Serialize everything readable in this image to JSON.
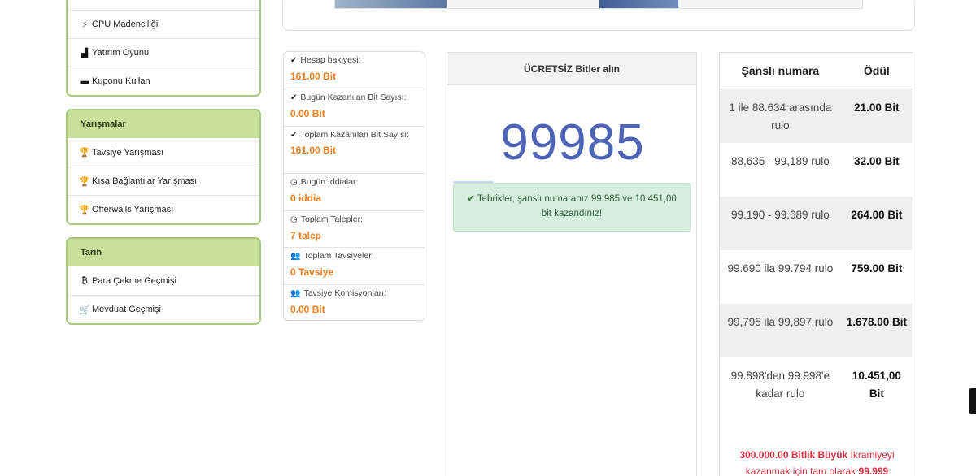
{
  "sidebar": {
    "top_items": [
      {
        "icon": "bolt-icon",
        "glyph": "⚡",
        "label": "CPU Madenciliği"
      },
      {
        "icon": "chart-icon",
        "glyph": "▟",
        "label": "Yatırım Oyunu"
      },
      {
        "icon": "ticket-icon",
        "glyph": "▬",
        "label": "Kuponu Kullan"
      }
    ],
    "contests": {
      "title": "Yarışmalar",
      "items": [
        {
          "icon": "trophy-icon",
          "glyph": "🏆",
          "label": "Tavsiye Yarışması"
        },
        {
          "icon": "trophy-icon",
          "glyph": "🏆",
          "label": "Kısa Bağlantılar Yarışması"
        },
        {
          "icon": "trophy-icon",
          "glyph": "🏆",
          "label": "Offerwalls Yarışması"
        }
      ]
    },
    "history": {
      "title": "Tarih",
      "items": [
        {
          "icon": "bitcoin-icon",
          "glyph": "₿",
          "label": "Para Çekme Geçmişi"
        },
        {
          "icon": "cart-icon",
          "glyph": "🛒",
          "label": "Mevduat Geçmişi"
        }
      ]
    }
  },
  "stats": [
    {
      "icon": "check-circle-icon",
      "glyph": "✔",
      "label": "Hesap bakiyesi:",
      "value": "161.00 Bit"
    },
    {
      "icon": "check-circle-icon",
      "glyph": "✔",
      "label": "Bugün Kazanılan Bit Sayısı:",
      "value": "0.00 Bit"
    },
    {
      "icon": "check-circle-icon",
      "glyph": "✔",
      "label": "Toplam Kazanılan Bit Sayısı:",
      "value": "161.00 Bit"
    },
    {
      "icon": "clock-icon",
      "glyph": "◷",
      "label": "Bugün İddialar:",
      "value": "0 iddia"
    },
    {
      "icon": "clock-icon",
      "glyph": "◷",
      "label": "Toplam Talepler:",
      "value": "7 talep"
    },
    {
      "icon": "users-icon",
      "glyph": "👥",
      "label": "Toplam Tavsiyeler:",
      "value": "0 Tavsiye"
    },
    {
      "icon": "users-icon",
      "glyph": "👥",
      "label": "Tavsiye Komisyonları:",
      "value": "0.00 Bit"
    }
  ],
  "free_panel": {
    "title": "ÜCRETSİZ Bitler alın",
    "lucky_number": "99985",
    "message": "Tebrikler, şanslı numaranız 99.985 ve 10.451,00 bit kazandınız!"
  },
  "prize_table": {
    "headers": [
      "Şanslı numara",
      "Ödül"
    ],
    "rows": [
      {
        "range": "1 ile 88.634 arasında rulo",
        "prize": "21.00 Bit"
      },
      {
        "range": "88,635 - 99,189 rulo",
        "prize": "32.00 Bit"
      },
      {
        "range": "99.190 - 99.689 rulo",
        "prize": "264.00 Bit"
      },
      {
        "range": "99.690 ila 99.794 rulo",
        "prize": "759.00 Bit"
      },
      {
        "range": "99,795 ila 99,897 rulo",
        "prize": "1.678.00 Bit"
      },
      {
        "range": "99.898'den 99.998'e kadar rulo",
        "prize": "10.451,00 Bit"
      }
    ],
    "jackpot": {
      "amount": "300.000.00 Bitlik Büyük",
      "text": " İkramiyeyi kazanmak için tam olarak ",
      "number": "99.999"
    }
  }
}
